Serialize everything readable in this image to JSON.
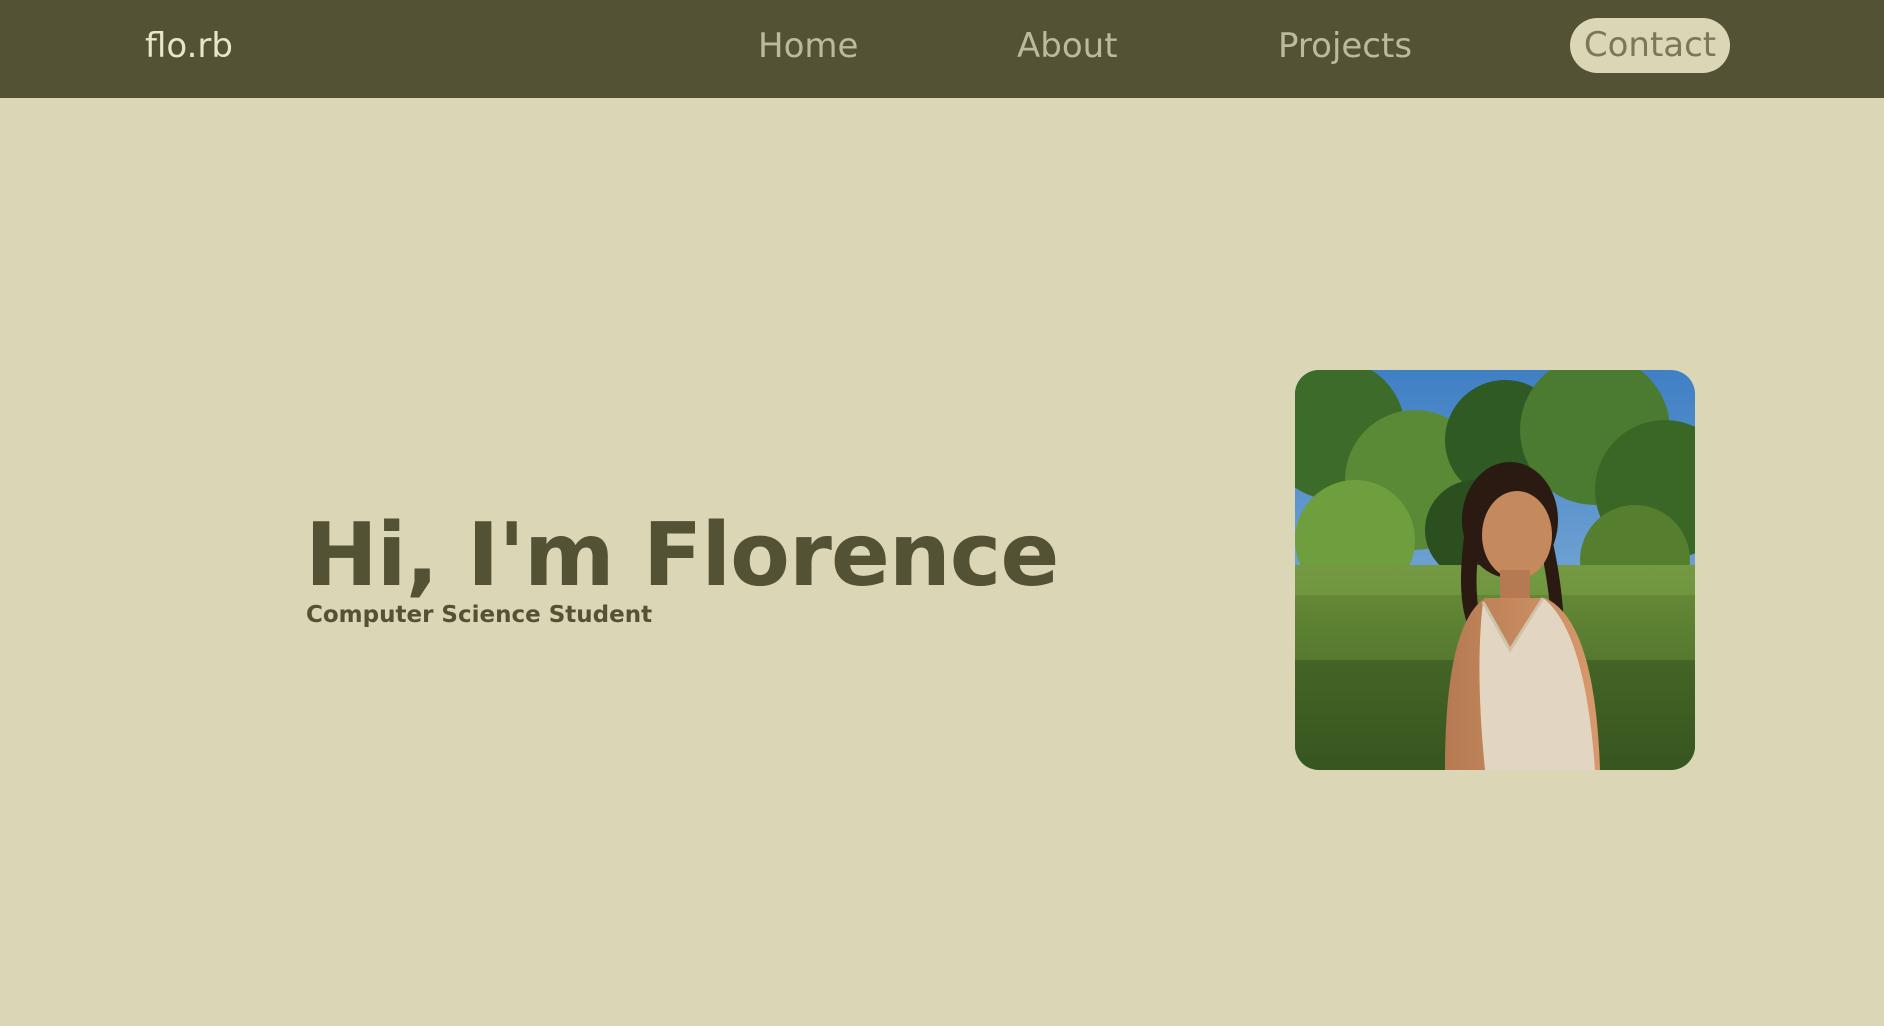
{
  "nav": {
    "logo": "flo.rb",
    "links": [
      {
        "label": "Home"
      },
      {
        "label": "About"
      },
      {
        "label": "Projects"
      },
      {
        "label": "Contact"
      }
    ]
  },
  "hero": {
    "title": "Hi, I'm Florence",
    "subtitle": "Computer Science Student"
  },
  "colors": {
    "background": "#dbd7b6",
    "navbar": "#535234",
    "nav_text": "#bcb99d",
    "accent_pill": "#dbd7b6",
    "heading": "#535234"
  }
}
